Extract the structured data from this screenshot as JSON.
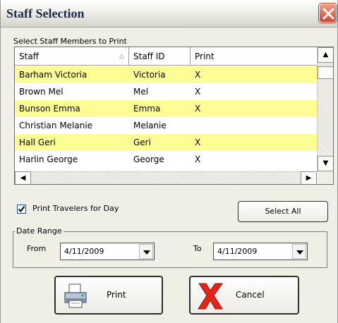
{
  "window": {
    "title": "Staff Selection"
  },
  "grid": {
    "caption": "Select Staff Members to Print",
    "columns": [
      "Staff",
      "Staff ID",
      "Print"
    ],
    "rows": [
      {
        "staff": "Barham Victoria",
        "id": "Victoria",
        "print": "X",
        "highlight": true
      },
      {
        "staff": "Brown Mel",
        "id": "Mel",
        "print": "X",
        "highlight": false
      },
      {
        "staff": "Bunson Emma",
        "id": "Emma",
        "print": "X",
        "highlight": true
      },
      {
        "staff": "Christian Melanie",
        "id": "Melanie",
        "print": "",
        "highlight": false
      },
      {
        "staff": "Hall Geri",
        "id": "Geri",
        "print": "X",
        "highlight": true
      },
      {
        "staff": "Harlin George",
        "id": "George",
        "print": "X",
        "highlight": false
      }
    ],
    "highlight_color": "#fdfd96"
  },
  "options": {
    "print_travelers_label": "Print Travelers for Day",
    "print_travelers_checked": true,
    "select_all_label": "Select All"
  },
  "date_range": {
    "legend": "Date Range",
    "from_label": "From",
    "from_value": "4/11/2009",
    "to_label": "To",
    "to_value": "4/11/2009"
  },
  "actions": {
    "print_label": "Print",
    "cancel_label": "Cancel"
  }
}
